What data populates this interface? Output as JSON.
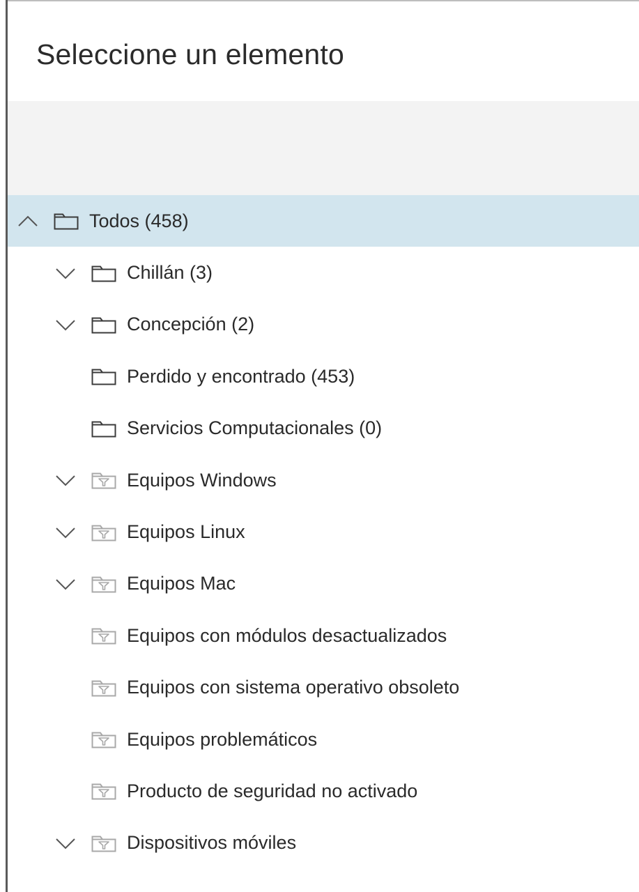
{
  "dialog": {
    "title": "Seleccione un elemento"
  },
  "colors": {
    "selected_row_bg": "#d2e5ee",
    "toolbar_bg": "#f3f3f3",
    "folder_icon": "#3b3b3b",
    "filter_icon": "#a8a8a8"
  },
  "tree": {
    "items": [
      {
        "label": "Todos (458)",
        "level": 0,
        "chevron": "up",
        "icon": "folder-icon",
        "selected": true
      },
      {
        "label": "Chillán (3)",
        "level": 1,
        "chevron": "down",
        "icon": "folder-icon",
        "selected": false
      },
      {
        "label": "Concepción (2)",
        "level": 1,
        "chevron": "down",
        "icon": "folder-icon",
        "selected": false
      },
      {
        "label": "Perdido y encontrado (453)",
        "level": 1,
        "chevron": "none",
        "icon": "folder-icon",
        "selected": false
      },
      {
        "label": "Servicios Computacionales (0)",
        "level": 1,
        "chevron": "none",
        "icon": "folder-icon",
        "selected": false
      },
      {
        "label": "Equipos Windows",
        "level": 1,
        "chevron": "down",
        "icon": "filter-folder-icon",
        "selected": false
      },
      {
        "label": "Equipos Linux",
        "level": 1,
        "chevron": "down",
        "icon": "filter-folder-icon",
        "selected": false
      },
      {
        "label": "Equipos Mac",
        "level": 1,
        "chevron": "down",
        "icon": "filter-folder-icon",
        "selected": false
      },
      {
        "label": "Equipos con módulos desactualizados",
        "level": 1,
        "chevron": "none",
        "icon": "filter-folder-icon",
        "selected": false
      },
      {
        "label": "Equipos con sistema operativo obsoleto",
        "level": 1,
        "chevron": "none",
        "icon": "filter-folder-icon",
        "selected": false
      },
      {
        "label": "Equipos problemáticos",
        "level": 1,
        "chevron": "none",
        "icon": "filter-folder-icon",
        "selected": false
      },
      {
        "label": "Producto de seguridad no activado",
        "level": 1,
        "chevron": "none",
        "icon": "filter-folder-icon",
        "selected": false
      },
      {
        "label": "Dispositivos móviles",
        "level": 1,
        "chevron": "down",
        "icon": "filter-folder-icon",
        "selected": false
      }
    ]
  }
}
